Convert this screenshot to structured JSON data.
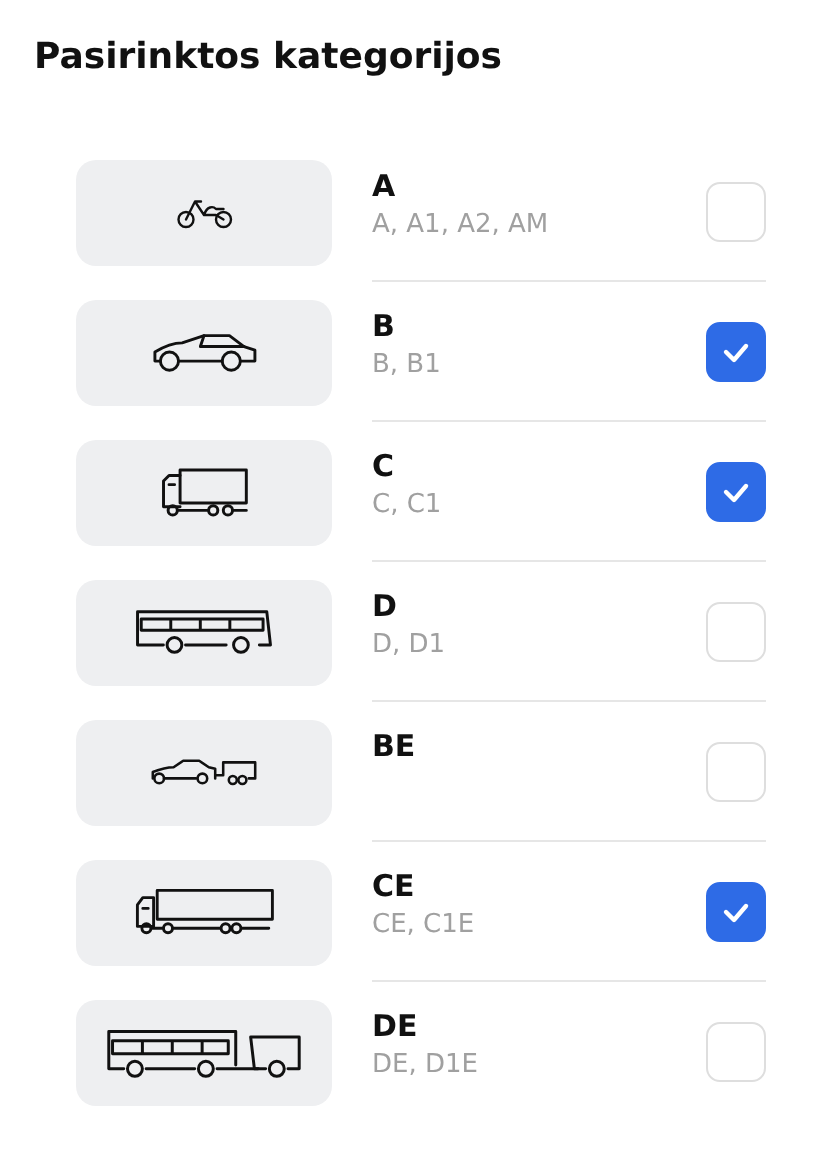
{
  "title": "Pasirinktos kategorijos",
  "categories": [
    {
      "kind": "motorcycle",
      "name": "A",
      "sub": "A, A1, A2, AM",
      "checked": false
    },
    {
      "kind": "car",
      "name": "B",
      "sub": "B, B1",
      "checked": true
    },
    {
      "kind": "truck",
      "name": "C",
      "sub": "C, C1",
      "checked": true
    },
    {
      "kind": "bus",
      "name": "D",
      "sub": "D, D1",
      "checked": false
    },
    {
      "kind": "car-trailer",
      "name": "BE",
      "checked": false
    },
    {
      "kind": "truck-trailer",
      "name": "CE",
      "sub": "CE, C1E",
      "checked": true
    },
    {
      "kind": "bus-trailer",
      "name": "DE",
      "sub": "DE, D1E",
      "checked": false
    }
  ]
}
